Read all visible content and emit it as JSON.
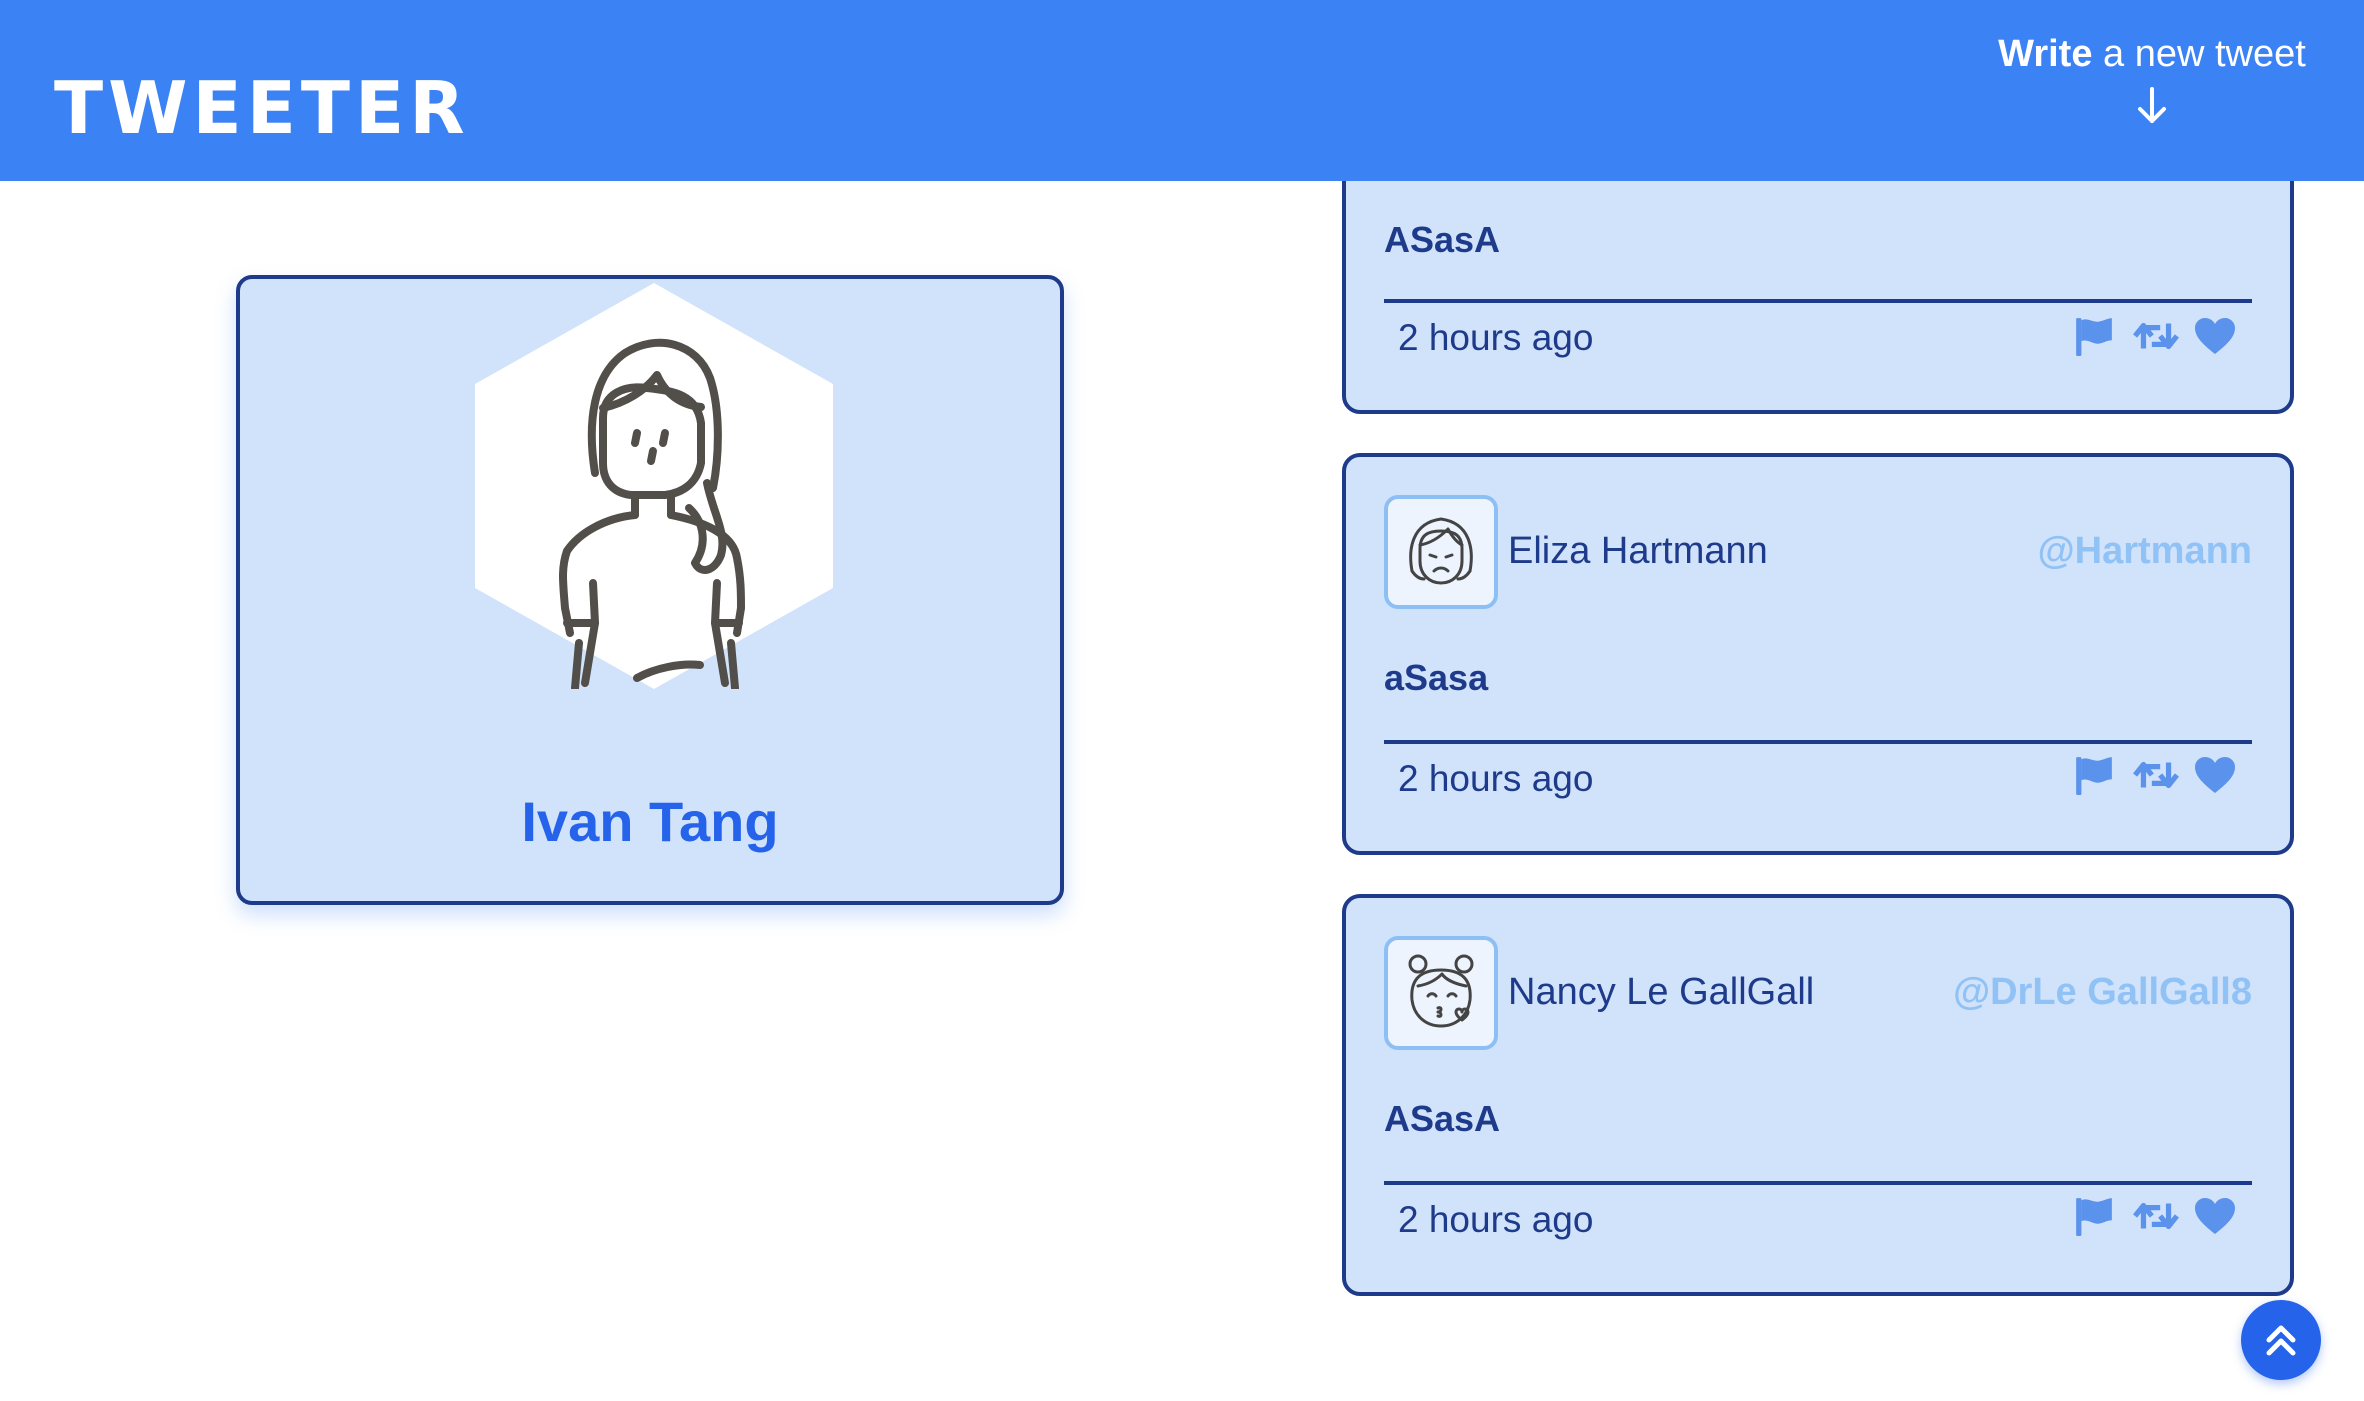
{
  "header": {
    "brand": "TWEETER",
    "compose_bold": "Write",
    "compose_rest": " a new tweet",
    "compose_icon": "arrow-down-icon"
  },
  "profile": {
    "name": "Ivan Tang",
    "avatar_icon": "woman-avatar-icon"
  },
  "tweets": [
    {
      "content": "ASasA",
      "time": "2 hours ago"
    },
    {
      "name": "Eliza Hartmann",
      "handle": "@Hartmann",
      "avatar_icon": "sad-girl-avatar-icon",
      "content": "aSasa",
      "time": "2 hours ago"
    },
    {
      "name": "Nancy Le GallGall",
      "handle": "@DrLe GallGall8",
      "avatar_icon": "kissing-girl-avatar-icon",
      "content": "ASasA",
      "time": "2 hours ago"
    }
  ],
  "action_icons": [
    "flag-icon",
    "retweet-icon",
    "heart-icon"
  ],
  "scroll_top_icon": "double-chevron-up-icon",
  "colors": {
    "header": "#3b82f4",
    "card": "#d1e2fb",
    "border": "#1e3a8a",
    "accent": "#2563eb",
    "handle": "#90c2f6",
    "action": "#5b92ec"
  }
}
